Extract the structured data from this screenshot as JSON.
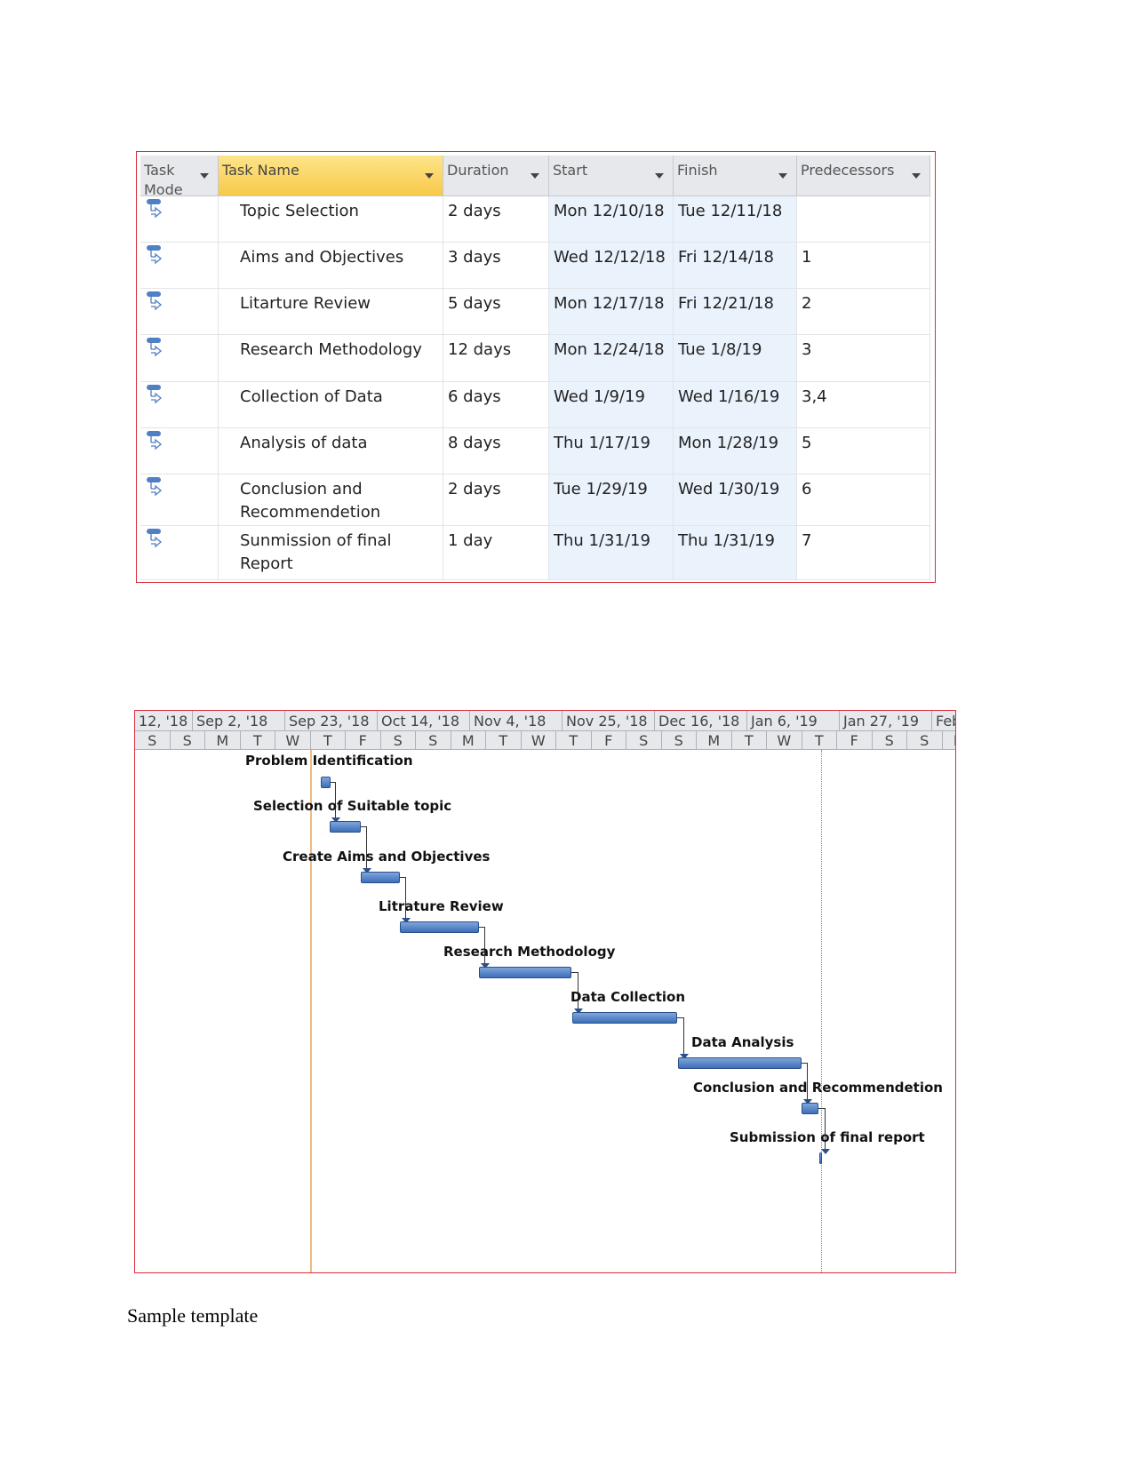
{
  "table": {
    "headers": [
      "Task Mode",
      "Task Name",
      "Duration",
      "Start",
      "Finish",
      "Predecessors"
    ],
    "rows": [
      {
        "name": "Topic Selection",
        "duration": "2 days",
        "start": "Mon 12/10/18",
        "finish": "Tue 12/11/18",
        "pred": ""
      },
      {
        "name": "Aims and Objectives",
        "duration": "3 days",
        "start": "Wed 12/12/18",
        "finish": "Fri 12/14/18",
        "pred": "1"
      },
      {
        "name": "Litarture Review",
        "duration": "5 days",
        "start": "Mon 12/17/18",
        "finish": "Fri 12/21/18",
        "pred": "2"
      },
      {
        "name": "Research Methodology",
        "duration": "12 days",
        "start": "Mon 12/24/18",
        "finish": "Tue 1/8/19",
        "pred": "3"
      },
      {
        "name": "Collection of Data",
        "duration": "6 days",
        "start": "Wed 1/9/19",
        "finish": "Wed 1/16/19",
        "pred": "3,4"
      },
      {
        "name": "Analysis of data",
        "duration": "8 days",
        "start": "Thu 1/17/19",
        "finish": "Mon 1/28/19",
        "pred": "5"
      },
      {
        "name": "Conclusion and Recommendetion",
        "duration": "2 days",
        "start": "Tue 1/29/19",
        "finish": "Wed 1/30/19",
        "pred": "6"
      },
      {
        "name": "Sunmission of final Report",
        "duration": "1 day",
        "start": "Thu 1/31/19",
        "finish": "Thu 1/31/19",
        "pred": "7"
      }
    ],
    "task_mode_icon": "auto-scheduled-task-icon",
    "header_highlight_color": "#f8c94a",
    "border_color": "#d9303a"
  },
  "gantt": {
    "top_tier": [
      "12, '18",
      "Sep 2, '18",
      "Sep 23, '18",
      "Oct 14, '18",
      "Nov 4, '18",
      "Nov 25, '18",
      "Dec 16, '18",
      "Jan 6, '19",
      "Jan 27, '19",
      "Feb"
    ],
    "bottom_tier": [
      "S",
      "S",
      "M",
      "T",
      "W",
      "T",
      "F",
      "S",
      "S",
      "M",
      "T",
      "W",
      "T",
      "F",
      "S",
      "S",
      "M",
      "T",
      "W",
      "T",
      "F",
      "S",
      "S",
      "M"
    ],
    "tasks": [
      "Problem Identification",
      "Selection of Suitable topic",
      "Create Aims and Objectives",
      "Litrature Review",
      "Research Methodology",
      "Data Collection",
      "Data Analysis",
      "Conclusion and Recommendetion",
      "Submission of final report"
    ],
    "bar_color": "#4f7fc4"
  },
  "caption": "Sample template"
}
